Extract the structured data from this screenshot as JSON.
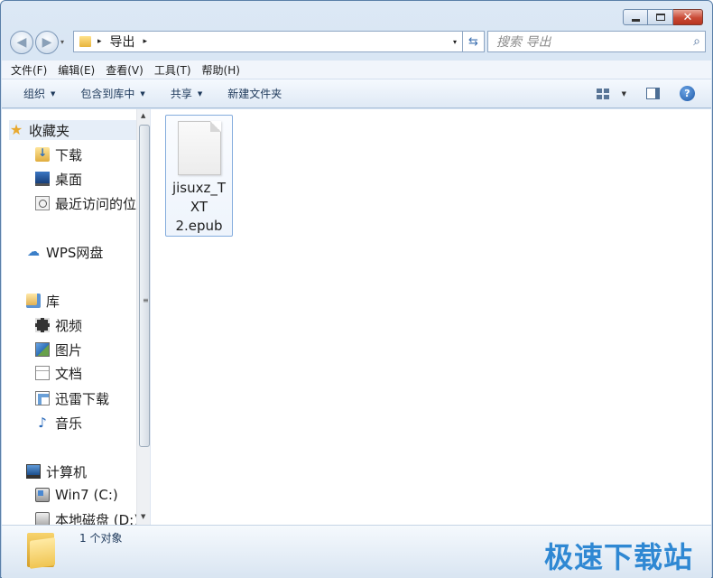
{
  "window": {
    "minimize_glyph": "—",
    "maximize_glyph": "□",
    "close_glyph": "✕"
  },
  "address_bar": {
    "path_separator_1": "▸",
    "path_current": "导出",
    "path_separator_2": "▸",
    "dropdown_glyph": "▾",
    "refresh_glyph": "⇆"
  },
  "search": {
    "placeholder": "搜索 导出",
    "icon": "search-icon"
  },
  "menu": {
    "items": [
      "文件(F)",
      "编辑(E)",
      "查看(V)",
      "工具(T)",
      "帮助(H)"
    ]
  },
  "toolbar": {
    "organize": "组织",
    "include_in_library": "包含到库中",
    "share": "共享",
    "new_folder": "新建文件夹",
    "help_glyph": "?"
  },
  "nav_pane": {
    "favorites": "收藏夹",
    "favorites_items": [
      "下载",
      "桌面",
      "最近访问的位置"
    ],
    "wps": "WPS网盘",
    "libraries": "库",
    "libraries_items": [
      "视频",
      "图片",
      "文档",
      "迅雷下载",
      "音乐"
    ],
    "computer": "计算机",
    "computer_items": [
      "Win7 (C:)",
      "本地磁盘 (D:)"
    ]
  },
  "files": [
    {
      "name_lines": [
        "jisuxz_T",
        "XT",
        "2.epub"
      ]
    }
  ],
  "status": {
    "count_text": "1 个对象",
    "watermark": "极速下载站"
  },
  "colors": {
    "accent": "#2f88d3",
    "selection_border": "#84acdd",
    "frame": "#c9daee"
  }
}
